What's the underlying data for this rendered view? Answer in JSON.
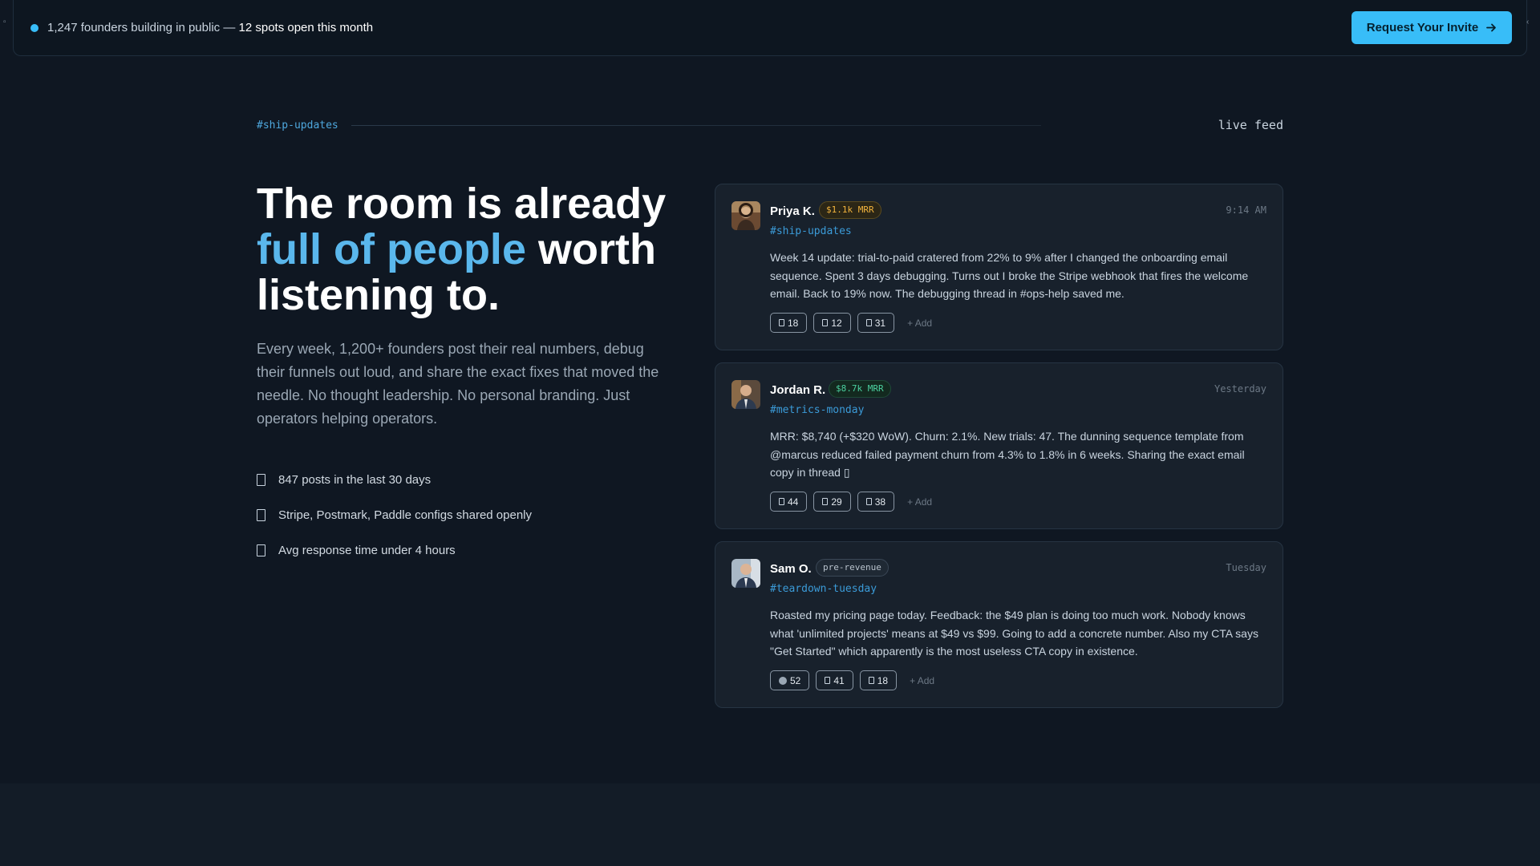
{
  "banner": {
    "founders_text": "1,247 founders building in public —",
    "spots_text": "12 spots open this month",
    "cta_label": "Request Your Invite",
    "cta_icon": "arrow-right-icon"
  },
  "section": {
    "channel_label": "#ship-updates",
    "right_label": "live feed"
  },
  "hero": {
    "title_line1": "The room is already",
    "title_accent": "full of people",
    "title_rest": " worth listening to.",
    "subtitle": "Every week, 1,200+ founders post their real numbers, debug their funnels out loud, and share the exact fixes that moved the needle. No thought leadership. No personal branding. Just operators helping operators.",
    "bullets": [
      "847 posts in the last 30 days",
      "Stripe, Postmark, Paddle configs shared openly",
      "Avg response time under 4 hours"
    ]
  },
  "feed": [
    {
      "author": "Priya K.",
      "badge": "$1.1k MRR",
      "badge_color": "#f2b33d",
      "channel": "#ship-updates",
      "time": "9:14 AM",
      "body": "Week 14 update: trial-to-paid cratered from 22% to 9% after I changed the onboarding email sequence. Spent 3 days debugging. Turns out I broke the Stripe webhook that fires the welcome email. Back to 19% now. The debugging thread in #ops-help saved me.",
      "reactions": [
        "18",
        "12",
        "31"
      ],
      "add_label": "+ Add"
    },
    {
      "author": "Jordan R.",
      "badge": "$8.7k MRR",
      "badge_color": "#4bd1a0",
      "channel": "#metrics-monday",
      "time": "Yesterday",
      "body": "MRR: $8,740 (+$320 WoW). Churn: 2.1%. New trials: 47. The dunning sequence template from @marcus reduced failed payment churn from 4.3% to 1.8% in 6 weeks. Sharing the exact email copy in thread ▯",
      "reactions": [
        "44",
        "29",
        "38"
      ],
      "add_label": "+ Add"
    },
    {
      "author": "Sam O.",
      "badge": "pre-revenue",
      "badge_color": "#b8c2cc",
      "channel": "#teardown-tuesday",
      "time": "Tuesday",
      "body": "Roasted my pricing page today. Feedback: the $49 plan is doing too much work. Nobody knows what 'unlimited projects' means at $49 vs $99. Going to add a concrete number. Also my CTA says \"Get Started\" which apparently is the most useless CTA copy in existence.",
      "reactions": [
        "52",
        "41",
        "18"
      ],
      "add_label": "+ Add"
    }
  ],
  "colors": {
    "background": "#0f1722",
    "accent": "#38bdf8",
    "card": "#18212c"
  }
}
